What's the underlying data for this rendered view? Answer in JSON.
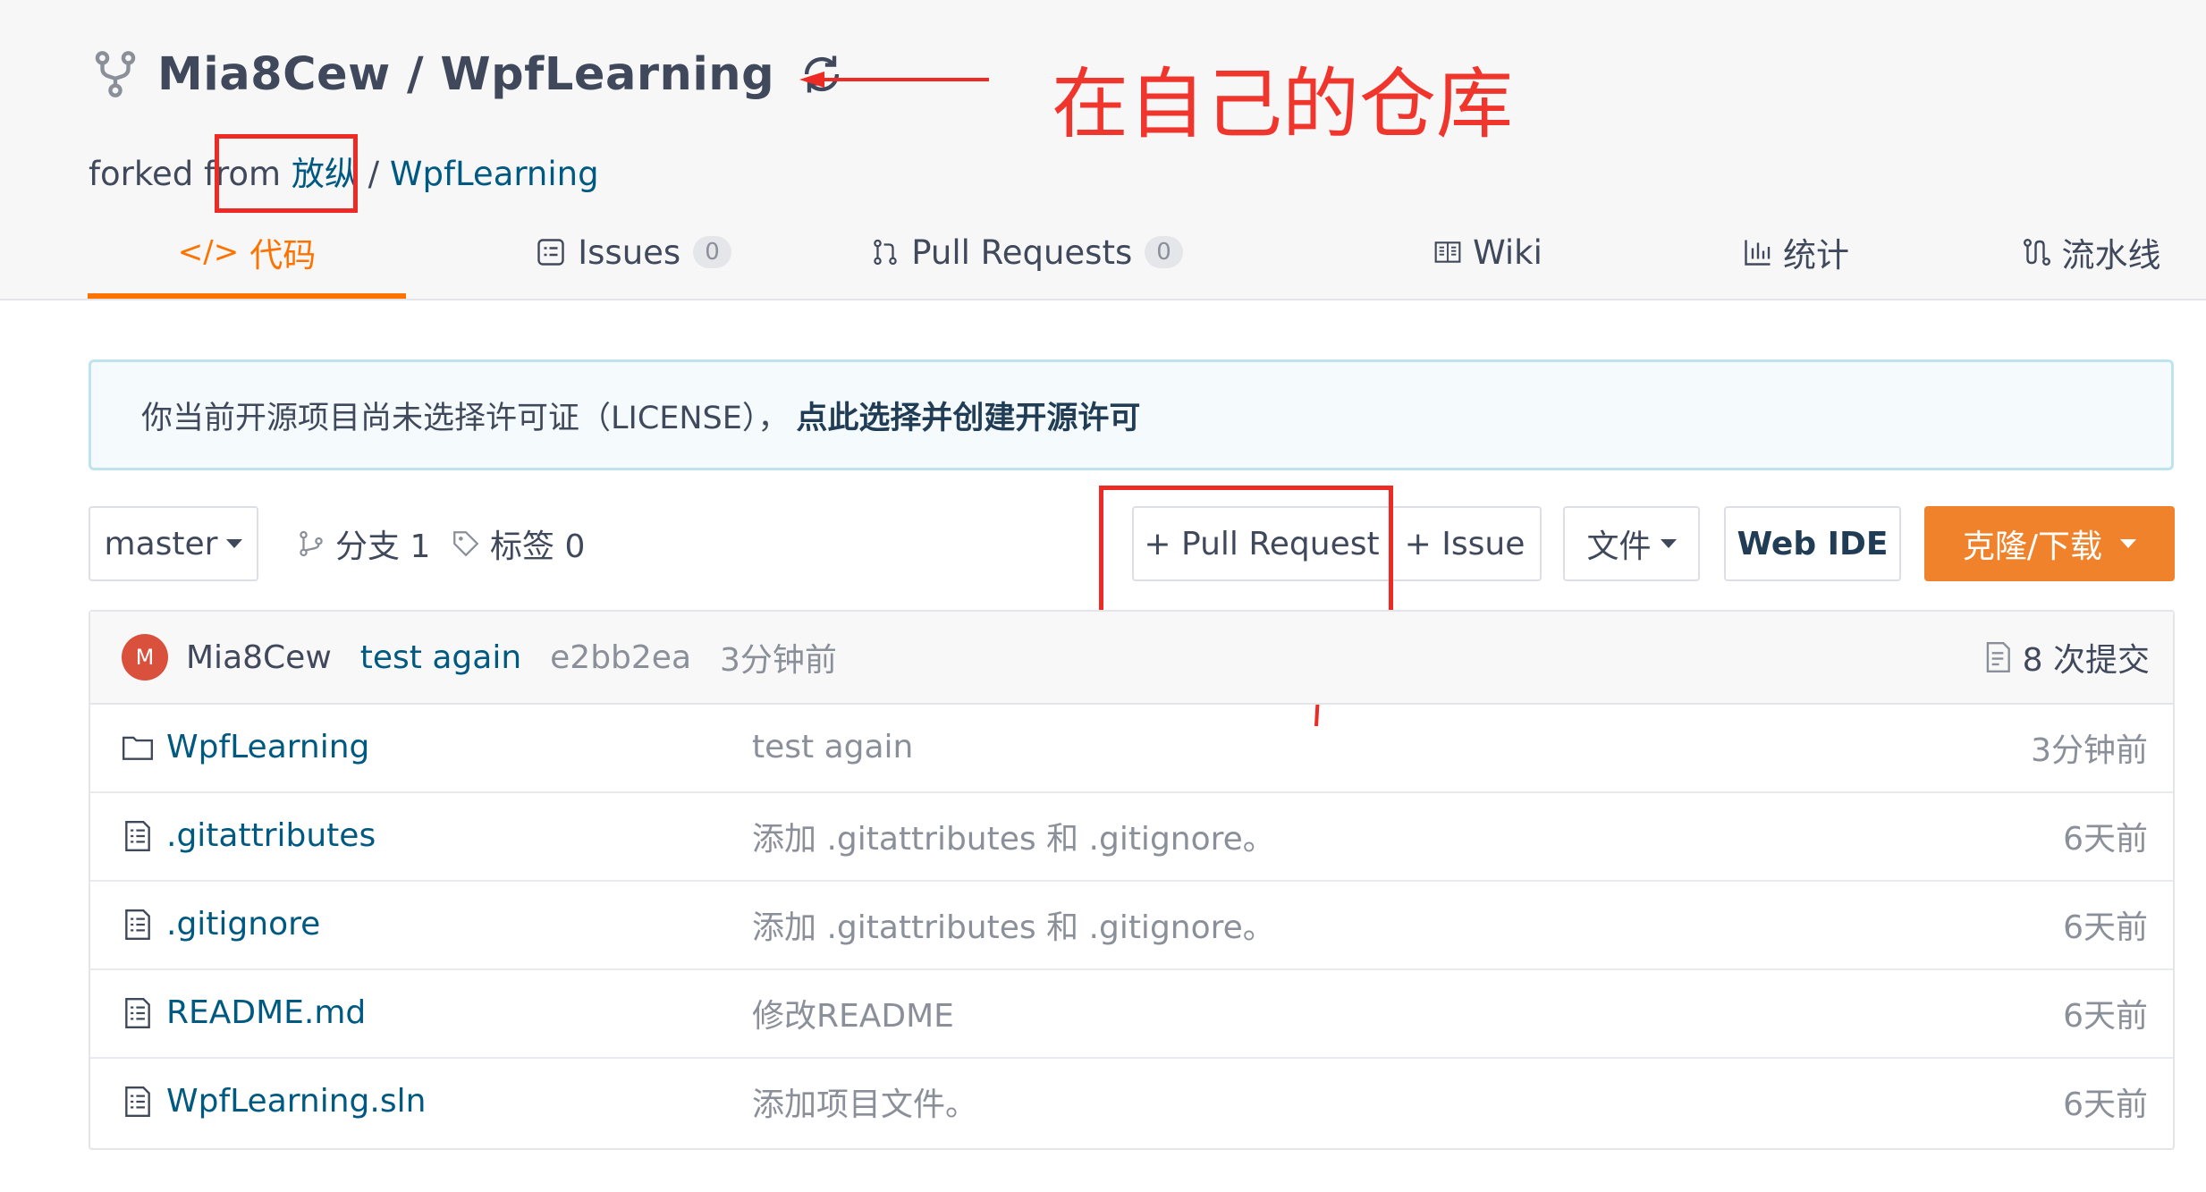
{
  "repo": {
    "title": "Mia8Cew / WpfLearning",
    "forked_prefix": "forked from ",
    "forked_owner": "放纵",
    "forked_sep": " / ",
    "forked_repo": "WpfLearning"
  },
  "annotation": {
    "text": "在自己的仓库",
    "color": "#f0352c"
  },
  "tabs": [
    {
      "icon": "code-icon",
      "label": "代码",
      "active": true
    },
    {
      "icon": "issues-icon",
      "label": "Issues",
      "count": "0"
    },
    {
      "icon": "pull-request-icon",
      "label": "Pull Requests",
      "count": "0"
    },
    {
      "icon": "wiki-icon",
      "label": "Wiki"
    },
    {
      "icon": "stats-icon",
      "label": "统计"
    },
    {
      "icon": "pipeline-icon",
      "label": "流水线"
    }
  ],
  "notice": {
    "text": "你当前开源项目尚未选择许可证（LICENSE），",
    "link": "点此选择并创建开源许可"
  },
  "toolbar": {
    "branch": "master",
    "branches_label": "分支 1",
    "tags_label": "标签 0",
    "pull_request": "+ Pull Request",
    "issue": "+ Issue",
    "files": "文件",
    "web_ide": "Web IDE",
    "clone": "克隆/下载"
  },
  "commit": {
    "avatar_letter": "M",
    "author": "Mia8Cew",
    "message": "test again",
    "sha": "e2bb2ea",
    "time": "3分钟前",
    "count": "8 次提交"
  },
  "files": [
    {
      "icon": "folder-icon",
      "name": "WpfLearning",
      "message": "test again",
      "time": "3分钟前"
    },
    {
      "icon": "file-icon",
      "name": ".gitattributes",
      "message": "添加 .gitattributes 和 .gitignore。",
      "time": "6天前"
    },
    {
      "icon": "file-icon",
      "name": ".gitignore",
      "message": "添加 .gitattributes 和 .gitignore。",
      "time": "6天前"
    },
    {
      "icon": "file-icon",
      "name": "README.md",
      "message": "修改README",
      "time": "6天前"
    },
    {
      "icon": "file-icon",
      "name": "WpfLearning.sln",
      "message": "添加项目文件。",
      "time": "6天前"
    }
  ],
  "colors": {
    "accent": "#fe7300",
    "clone_button": "#f0822c",
    "link": "#005980",
    "annotation_red": "#ee2a24"
  }
}
